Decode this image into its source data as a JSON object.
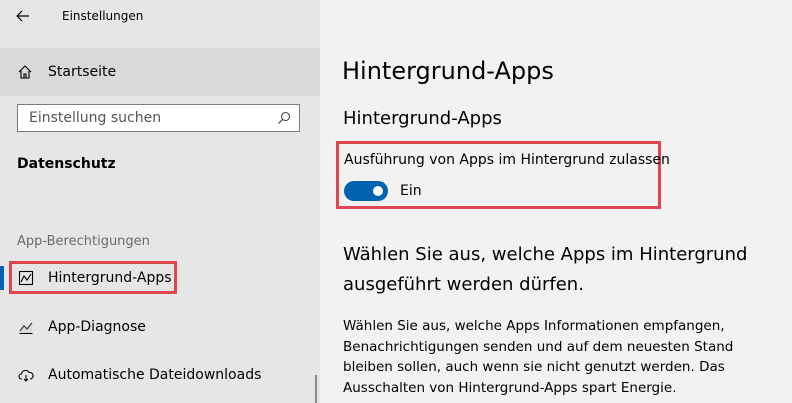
{
  "window": {
    "title": "Einstellungen"
  },
  "sidebar": {
    "home_label": "Startseite",
    "search_placeholder": "Einstellung suchen",
    "section_title": "Datenschutz",
    "group_header": "App-Berechtigungen",
    "items": [
      {
        "label": "Hintergrund-Apps",
        "icon": "background-apps-icon",
        "active": true
      },
      {
        "label": "App-Diagnose",
        "icon": "app-diagnostics-icon",
        "active": false
      },
      {
        "label": "Automatische Dateidownloads",
        "icon": "cloud-download-icon",
        "active": false
      }
    ]
  },
  "main": {
    "page_title": "Hintergrund-Apps",
    "subheading": "Hintergrund-Apps",
    "toggle": {
      "label": "Ausführung von Apps im Hintergrund zulassen",
      "state_label": "Ein",
      "on": true
    },
    "section_heading": "Wählen Sie aus, welche Apps im Hintergrund ausgeführt werden dürfen.",
    "description": "Wählen Sie aus, welche Apps Informationen empfangen, Benachrichtigungen senden und auf dem neuesten Stand bleiben sollen, auch wenn sie nicht genutzt werden. Das Ausschalten von Hintergrund-Apps spart Energie."
  },
  "colors": {
    "accent": "#0063b1",
    "highlight": "#e0464e",
    "sidebar_bg": "#e6e6e6",
    "main_bg": "#f2f2f2"
  }
}
